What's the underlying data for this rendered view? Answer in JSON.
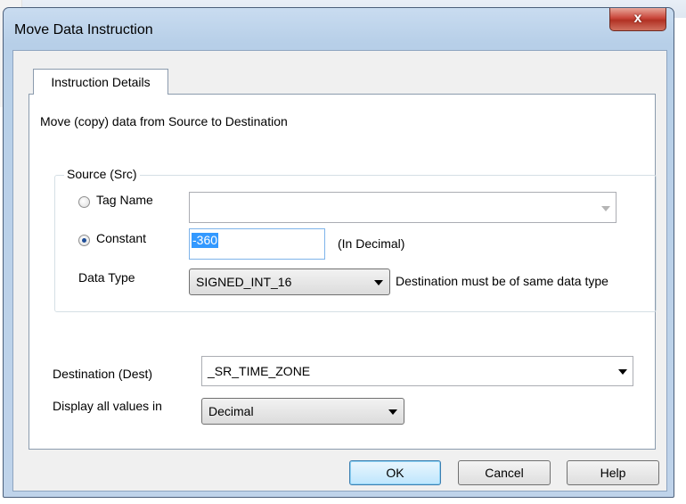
{
  "dialog": {
    "title": "Move Data Instruction",
    "close_glyph": "x",
    "tab_label": "Instruction Details",
    "description": "Move (copy) data from Source to Destination"
  },
  "source": {
    "group_label": "Source (Src)",
    "tag_name_label": "Tag Name",
    "tag_name_value": "",
    "constant_label": "Constant",
    "constant_value": "-360",
    "constant_hint": "(In Decimal)",
    "selected_option": "Constant",
    "data_type_label": "Data Type",
    "data_type_value": "SIGNED_INT_16",
    "data_type_note": "Destination must be of same data type"
  },
  "destination": {
    "label": "Destination (Dest)",
    "value": "_SR_TIME_ZONE"
  },
  "display": {
    "label": "Display all values in",
    "value": "Decimal"
  },
  "buttons": {
    "ok": "OK",
    "cancel": "Cancel",
    "help": "Help"
  },
  "colors": {
    "selection": "#3399ff",
    "close_button": "#c9463a",
    "panel": "#f0f0f0"
  }
}
